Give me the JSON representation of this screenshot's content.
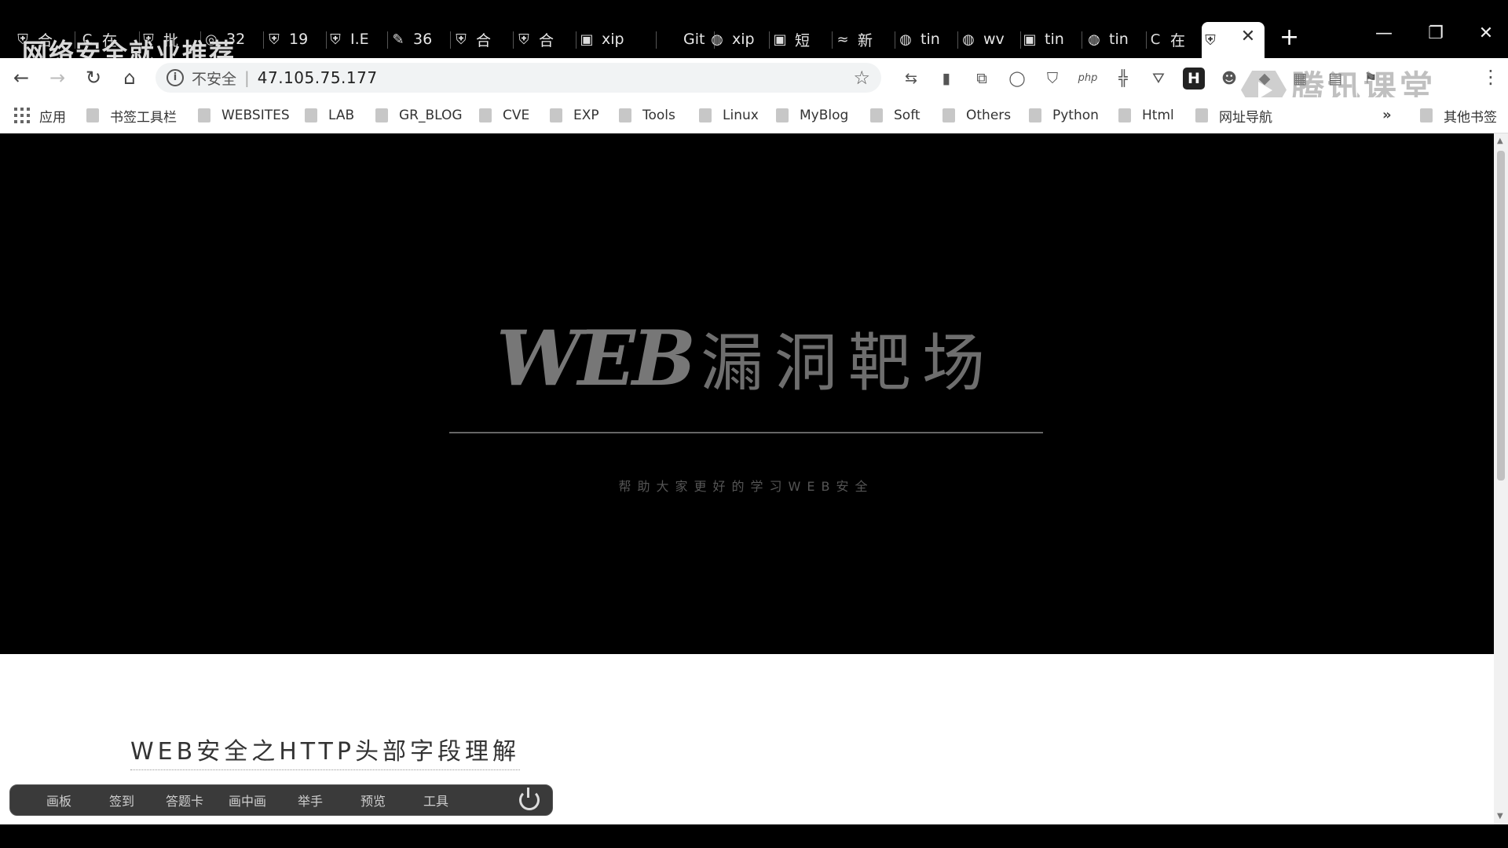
{
  "overlay": {
    "title": "网络安全就业推荐"
  },
  "tabs": [
    {
      "icon": "shield-icon",
      "glyph": "⛨",
      "label": "合"
    },
    {
      "icon": "c-logo-icon",
      "glyph": "C",
      "label": "在"
    },
    {
      "icon": "shield-icon",
      "glyph": "⛨",
      "label": "批"
    },
    {
      "icon": "chrome-icon",
      "glyph": "◎",
      "label": "32"
    },
    {
      "icon": "shield-icon",
      "glyph": "⛨",
      "label": "19"
    },
    {
      "icon": "shield-icon",
      "glyph": "⛨",
      "label": "I.E"
    },
    {
      "icon": "leaf-icon",
      "glyph": "✎",
      "label": "36"
    },
    {
      "icon": "shield-icon",
      "glyph": "⛨",
      "label": "合"
    },
    {
      "icon": "shield-icon",
      "glyph": "⛨",
      "label": "合"
    },
    {
      "icon": "paw-icon",
      "glyph": "▣",
      "label": "xip"
    },
    {
      "icon": "github-icon",
      "glyph": "",
      "label": "Git"
    },
    {
      "icon": "globe-icon",
      "glyph": "◍",
      "label": "xip"
    },
    {
      "icon": "paw-icon",
      "glyph": "▣",
      "label": "短"
    },
    {
      "icon": "page-icon",
      "glyph": "≈",
      "label": "新"
    },
    {
      "icon": "globe-icon",
      "glyph": "◍",
      "label": "tin"
    },
    {
      "icon": "globe-icon",
      "glyph": "◍",
      "label": "wv"
    },
    {
      "icon": "paw-icon",
      "glyph": "▣",
      "label": "tin"
    },
    {
      "icon": "globe-icon",
      "glyph": "◍",
      "label": "tin"
    },
    {
      "icon": "c-logo-icon",
      "glyph": "C",
      "label": "在"
    },
    {
      "icon": "shield-icon",
      "glyph": "⛨",
      "label": ""
    }
  ],
  "window": {
    "new_tab": "+",
    "minimize": "—",
    "restore": "❐",
    "close": "✕",
    "tab_close": "✕"
  },
  "toolbar": {
    "back": "←",
    "forward": "→",
    "reload": "↻",
    "home": "⌂",
    "insecure_label": "不安全",
    "url": "47.105.75.177",
    "star": "☆",
    "menu": "⋮"
  },
  "extensions": [
    {
      "name": "translate-ext-icon",
      "glyph": "⇆"
    },
    {
      "name": "bookmark-ext-icon",
      "glyph": "▮"
    },
    {
      "name": "screen-ext-icon",
      "glyph": "⧉"
    },
    {
      "name": "circle-ext-icon",
      "glyph": "◯"
    },
    {
      "name": "shield-ext-icon",
      "glyph": "⛉"
    },
    {
      "name": "php-ext-icon",
      "glyph": "php"
    },
    {
      "name": "network-ext-icon",
      "glyph": "╬"
    },
    {
      "name": "filter-ext-icon",
      "glyph": "⛛"
    },
    {
      "name": "h-ext-icon",
      "glyph": "H"
    },
    {
      "name": "user-ext-icon",
      "glyph": "☻"
    },
    {
      "name": "gem-ext-icon",
      "glyph": "◆"
    },
    {
      "name": "grid-ext-icon",
      "glyph": "▦"
    },
    {
      "name": "doc-ext-icon",
      "glyph": "▤"
    },
    {
      "name": "flag-ext-icon",
      "glyph": "⚑"
    }
  ],
  "watermark": {
    "text": "腾讯课堂"
  },
  "bookmarks": {
    "apps_label": "应用",
    "items": [
      "书签工具栏",
      "WEBSITES",
      "LAB",
      "GR_BLOG",
      "CVE",
      "EXP",
      "Tools",
      "Linux",
      "MyBlog",
      "Soft",
      "Others",
      "Python",
      "Html",
      "网址导航"
    ],
    "more": "»",
    "other_label": "其他书签"
  },
  "hero": {
    "title_latin": "WEB",
    "title_cn": "漏洞靶场",
    "subtitle": "帮助大家更好的学习WEB安全"
  },
  "article": {
    "title": "WEB安全之HTTP头部字段理解"
  },
  "floatbar": {
    "items": [
      "画板",
      "签到",
      "答题卡",
      "画中画",
      "举手",
      "预览",
      "工具"
    ]
  }
}
